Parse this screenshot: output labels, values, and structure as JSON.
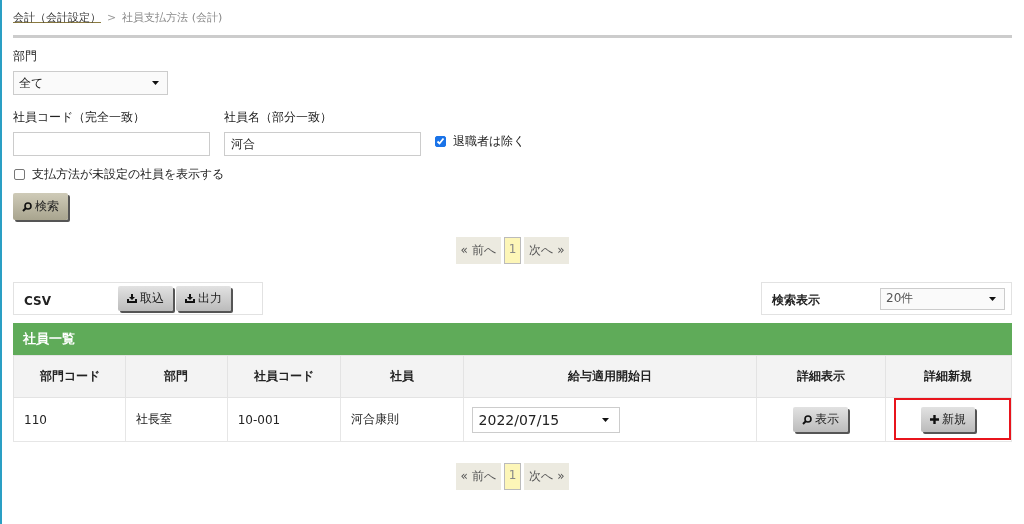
{
  "breadcrumb": {
    "link": "会計（会計設定）",
    "separator": ">",
    "current": "社員支払方法 (会計)"
  },
  "department": {
    "label": "部門",
    "value": "全て"
  },
  "employee_code": {
    "label": "社員コード（完全一致）"
  },
  "employee_name": {
    "label": "社員名（部分一致）",
    "value": "河合"
  },
  "exclude_retired": {
    "label": "退職者は除く",
    "checked": true
  },
  "show_unset": {
    "label": "支払方法が未設定の社員を表示する",
    "checked": false
  },
  "search_button": "検索",
  "pagination_top": [
    {
      "label": "« 前へ",
      "selected": false
    },
    {
      "label": "1",
      "selected": true
    },
    {
      "label": "次へ »",
      "selected": false
    }
  ],
  "csv": {
    "label": "CSV",
    "buttons": [
      "取込",
      "出力"
    ]
  },
  "display": {
    "label": "検索表示",
    "value": "20件"
  },
  "table": {
    "title": "社員一覧",
    "columns": [
      "部門コード",
      "部門",
      "社員コード",
      "社員",
      "給与適用開始日",
      "詳細表示",
      "詳細新規"
    ],
    "rows": [
      {
        "dept_code": "110",
        "dept": "社長室",
        "emp_code": "10-001",
        "name": "河合康則",
        "start_date": "2022/07/15",
        "view_button": "表示",
        "new_button": "新規",
        "new_highlighted": true
      }
    ]
  },
  "pagination_bottom": [
    {
      "label": "« 前へ",
      "selected": false
    },
    {
      "label": "1",
      "selected": true
    },
    {
      "label": "次へ »",
      "selected": false
    }
  ]
}
